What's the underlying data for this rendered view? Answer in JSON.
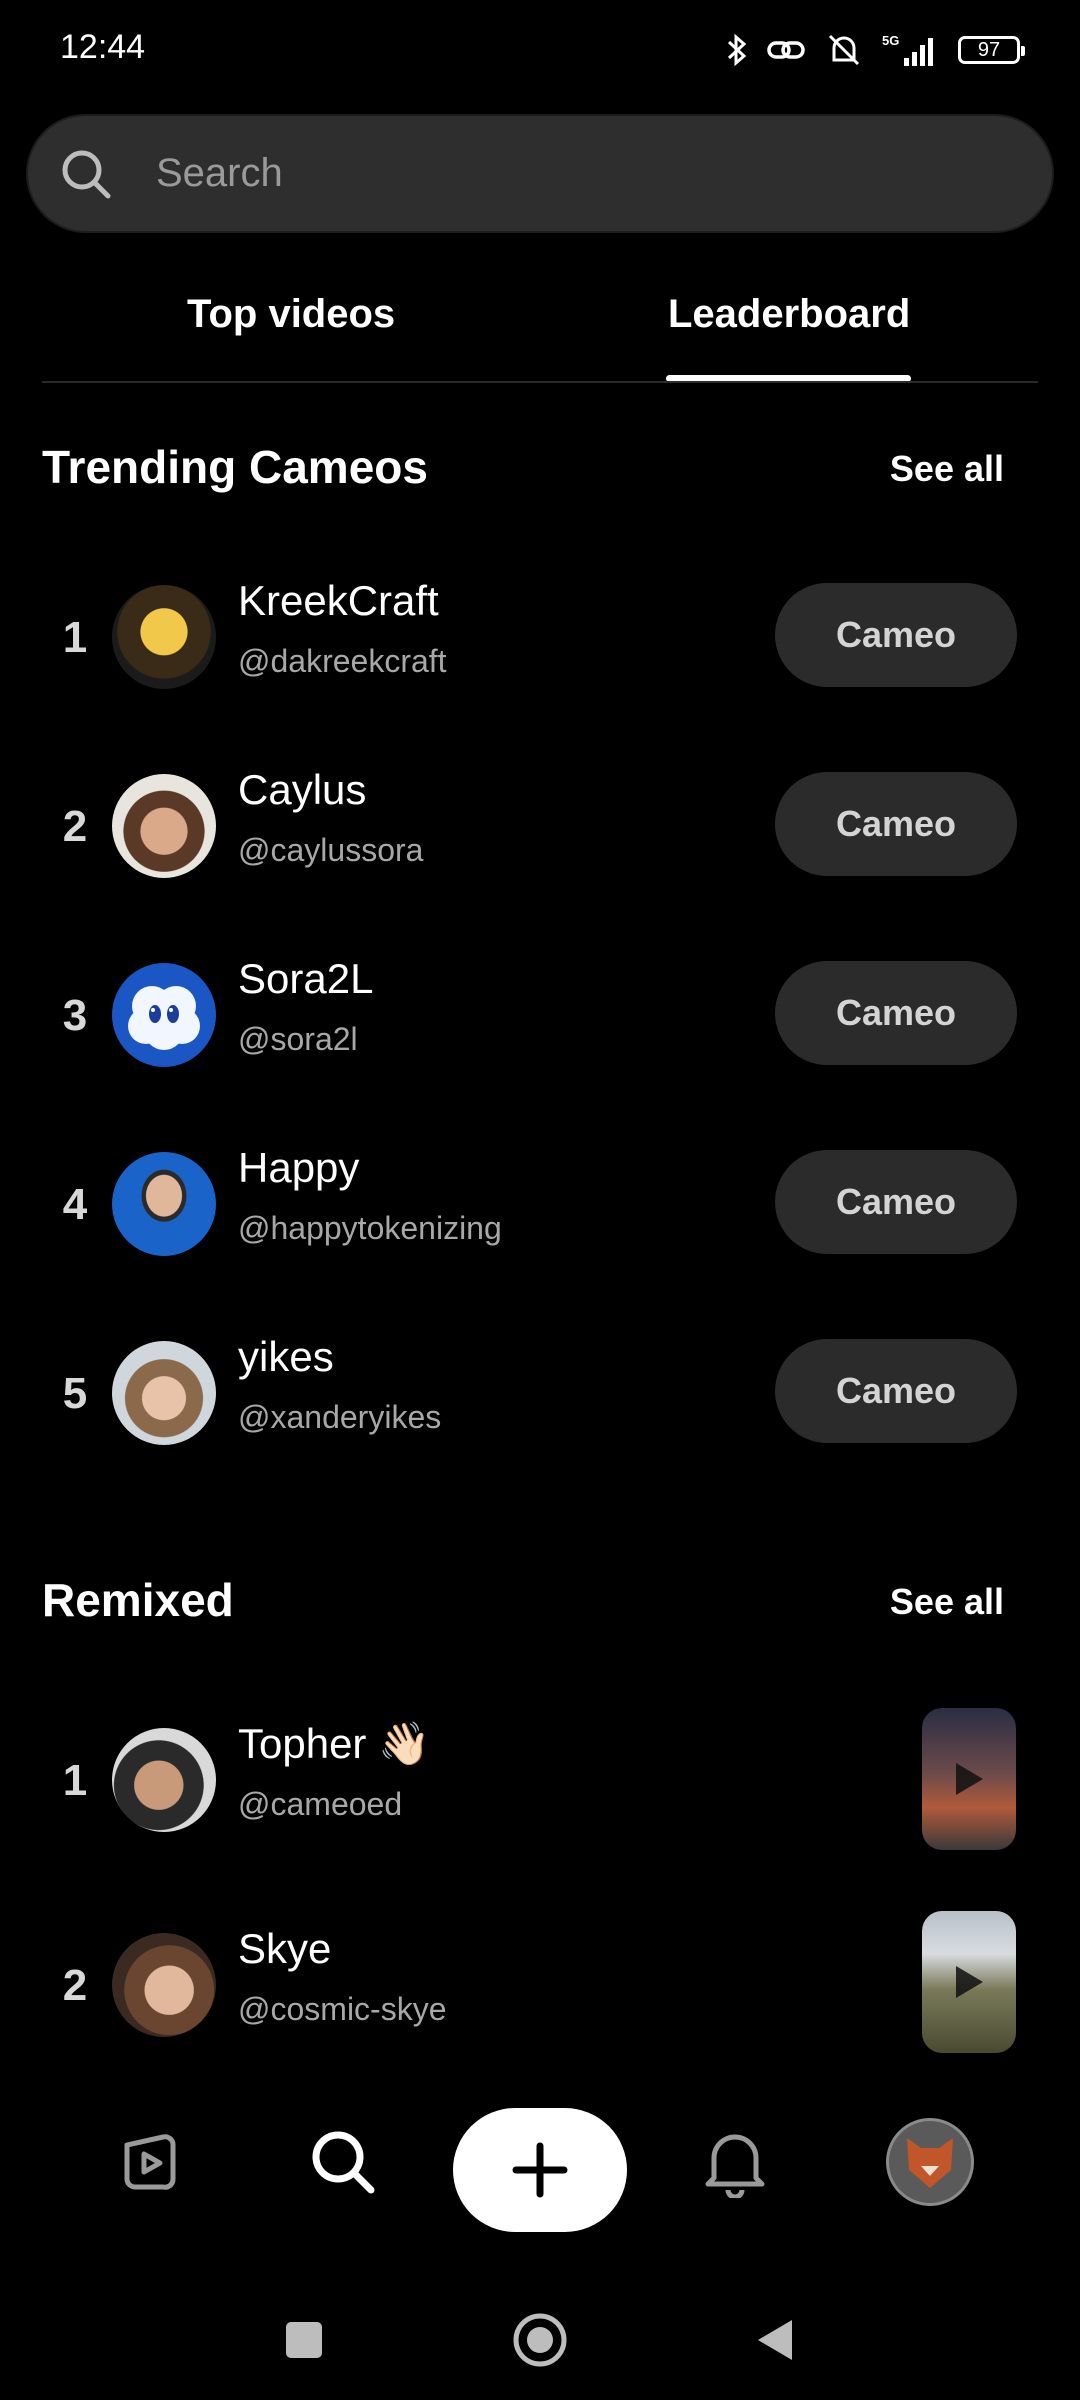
{
  "status_bar": {
    "time": "12:44",
    "network": "5G",
    "battery": "97"
  },
  "search": {
    "placeholder": "Search"
  },
  "tabs": [
    {
      "label": "Top videos"
    },
    {
      "label": "Leaderboard",
      "active": true
    }
  ],
  "trending": {
    "title": "Trending Cameos",
    "see_all": "See all",
    "items": [
      {
        "rank": "1",
        "name": "KreekCraft",
        "handle": "@dakreekcraft",
        "button": "Cameo"
      },
      {
        "rank": "2",
        "name": "Caylus",
        "handle": "@caylussora",
        "button": "Cameo"
      },
      {
        "rank": "3",
        "name": "Sora2L",
        "handle": "@sora2l",
        "button": "Cameo"
      },
      {
        "rank": "4",
        "name": "Happy",
        "handle": "@happytokenizing",
        "button": "Cameo"
      },
      {
        "rank": "5",
        "name": "yikes",
        "handle": "@xanderyikes",
        "button": "Cameo"
      }
    ]
  },
  "remixed": {
    "title": "Remixed",
    "see_all": "See all",
    "items": [
      {
        "rank": "1",
        "name": "Topher 👋🏻",
        "handle": "@cameoed"
      },
      {
        "rank": "2",
        "name": "Skye",
        "handle": "@cosmic-skye"
      }
    ]
  },
  "bottom_nav": [
    "feed-icon",
    "search-icon",
    "plus-icon",
    "bell-icon",
    "profile-avatar"
  ],
  "colors": {
    "background": "#000000",
    "pill": "#2b2b2b",
    "accent": "#ffffff"
  }
}
